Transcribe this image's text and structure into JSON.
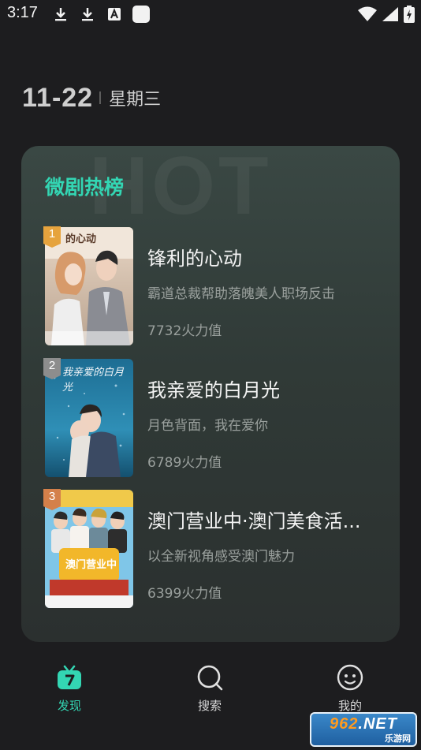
{
  "status_bar": {
    "time": "3:17",
    "left_icons": [
      "download-icon",
      "download-icon",
      "font-icon",
      "app-icon"
    ],
    "right_icons": [
      "wifi-icon",
      "signal-icon",
      "battery-icon"
    ]
  },
  "header": {
    "date": "11-22",
    "weekday": "星期三"
  },
  "card": {
    "watermark": "HOT",
    "title": "微剧热榜",
    "accent_color": "#33d6b3",
    "items": [
      {
        "rank": "1",
        "rank_color": "#e6a33d",
        "title": "锋利的心动",
        "description": "霸道总裁帮助落魄美人职场反击",
        "heat": "7732火力值",
        "poster_overlay_text": "的心动"
      },
      {
        "rank": "2",
        "rank_color": "#8d8d8d",
        "title": "我亲爱的白月光",
        "description": "月色背面，我在爱你",
        "heat": "6789火力值",
        "poster_overlay_text": "我亲爱的白月光"
      },
      {
        "rank": "3",
        "rank_color": "#d4804a",
        "title": "澳门营业中·澳门美食活...",
        "description": "以全新视角感受澳门魅力",
        "heat": "6399火力值",
        "poster_overlay_text": "澳门营业中"
      }
    ]
  },
  "nav": {
    "items": [
      {
        "label": "发现",
        "icon": "tv-icon",
        "active": true
      },
      {
        "label": "搜索",
        "icon": "search-icon",
        "active": false
      },
      {
        "label": "我的",
        "icon": "smiley-icon",
        "active": false
      }
    ]
  },
  "site_watermark": {
    "brand_prefix": "962",
    "brand_suffix": ".NET",
    "subtitle": "乐游网"
  }
}
